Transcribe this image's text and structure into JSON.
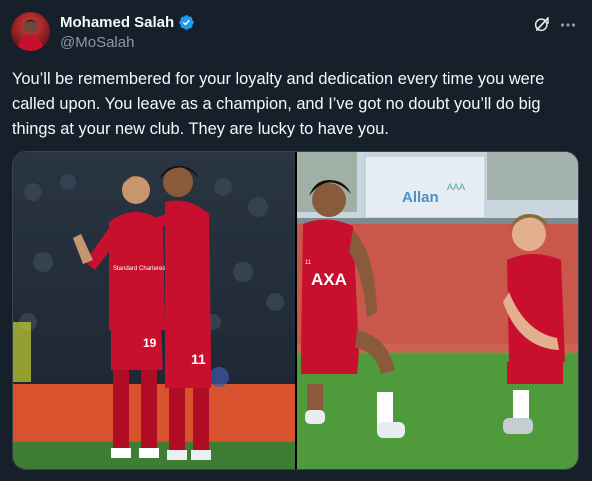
{
  "author": {
    "display_name": "Mohamed Salah",
    "handle": "@MoSalah",
    "verified_icon": "verified-badge-icon",
    "avatar_icon": "avatar"
  },
  "header_actions": {
    "grok_icon": "grok-icon",
    "more_icon": "more-options-icon"
  },
  "tweet": {
    "text": "You’ll be remembered for your loyalty and dedication every time you were called upon. You leave as a champion, and I’ve got no doubt you’ll do big things at your new club. They are lucky to have you."
  },
  "media": {
    "left_photo": {
      "shirt_number_left": "19",
      "shirt_number_right": "11",
      "sponsor": "Standard Chartered"
    },
    "right_photo": {
      "banner_text": "Allan",
      "banner_text_2": "AAA",
      "sponsor": "AXA",
      "shirt_number": "11"
    }
  },
  "colors": {
    "background": "#15202b",
    "text": "#f7f9f9",
    "secondary_text": "#8b98a5",
    "verified": "#1d9bf0",
    "liverpool_red": "#c8102e"
  }
}
